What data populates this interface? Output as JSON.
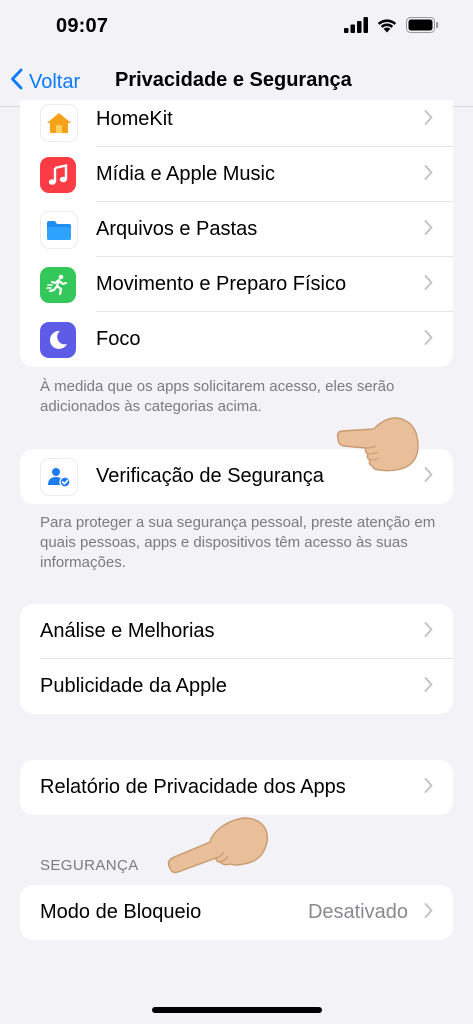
{
  "status_bar": {
    "time": "09:07"
  },
  "nav": {
    "back_label": "Voltar",
    "title": "Privacidade e Segurança"
  },
  "group1": {
    "items": [
      {
        "label": "HomeKit",
        "icon": "home-icon"
      },
      {
        "label": "Mídia e Apple Music",
        "icon": "music-note-icon"
      },
      {
        "label": "Arquivos e Pastas",
        "icon": "folder-icon"
      },
      {
        "label": "Movimento e Preparo Físico",
        "icon": "running-figure-icon"
      },
      {
        "label": "Foco",
        "icon": "moon-icon"
      }
    ],
    "footer": "À medida que os apps solicitarem acesso, eles serão adicionados às categorias acima."
  },
  "group2": {
    "items": [
      {
        "label": "Verificação de Segurança",
        "icon": "safety-check-icon"
      }
    ],
    "footer": "Para proteger a sua segurança pessoal, preste atenção em quais pessoas, apps e dispositivos têm acesso às suas informações."
  },
  "group3": {
    "items": [
      {
        "label": "Análise e Melhorias"
      },
      {
        "label": "Publicidade da Apple"
      }
    ]
  },
  "group4": {
    "items": [
      {
        "label": "Relatório de Privacidade dos Apps"
      }
    ]
  },
  "security_section": {
    "header": "SEGURANÇA",
    "items": [
      {
        "label": "Modo de Bloqueio",
        "value": "Desativado"
      }
    ]
  },
  "colors": {
    "accent": "#0a7aff",
    "background": "#f2f2f7",
    "music": "#fc3c44",
    "folder": "#1e8cf0",
    "fitness": "#34c759",
    "focus": "#5e5ce6",
    "home": "#f7a21b"
  }
}
